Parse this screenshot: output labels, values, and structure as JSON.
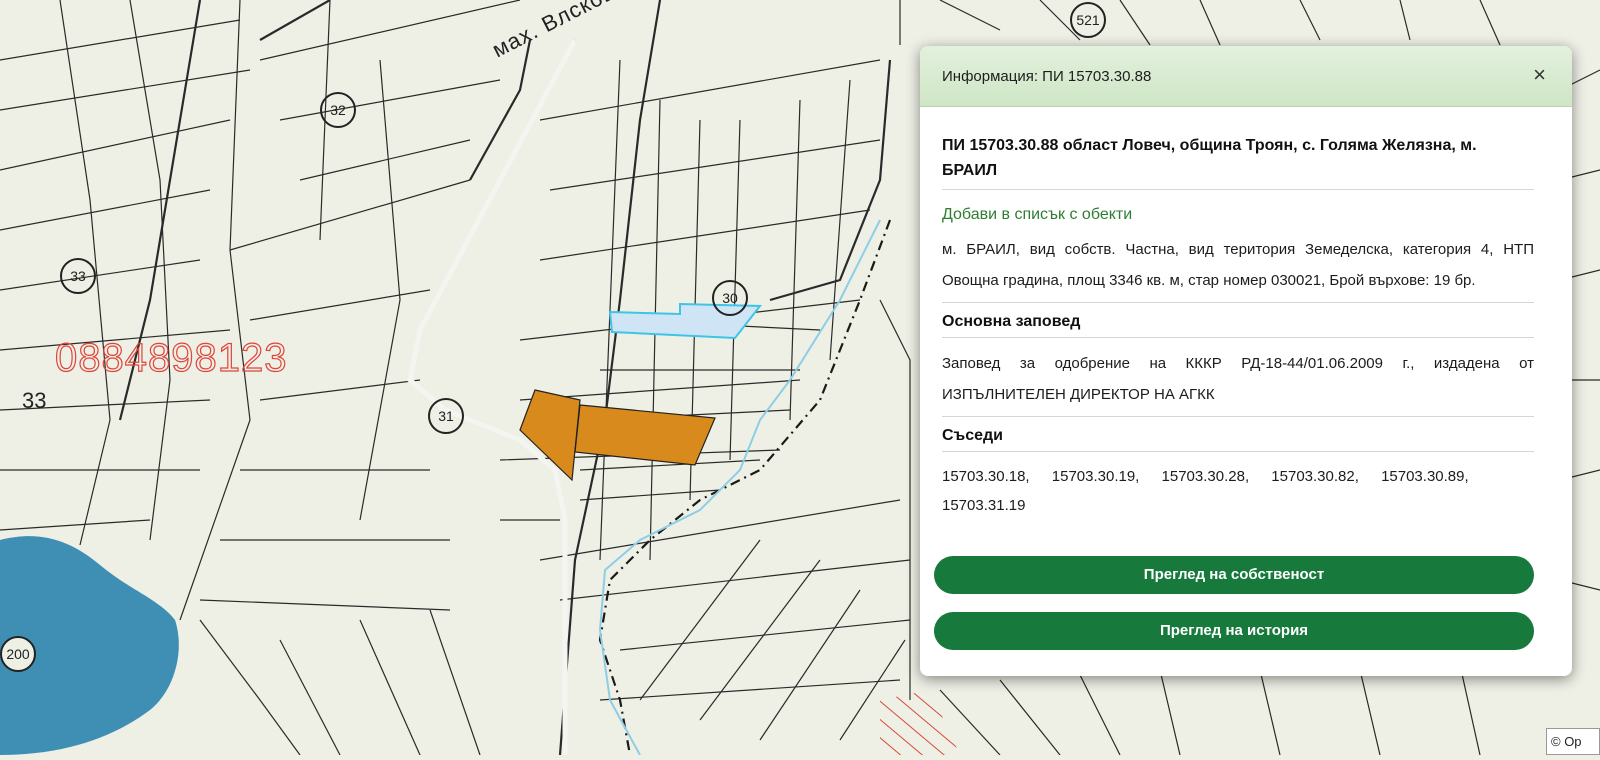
{
  "map": {
    "street_label": "мах. Влсково",
    "watermark": "0884898123",
    "text_33": "33",
    "plot_numbers": [
      "32",
      "33",
      "30",
      "31",
      "200",
      "521"
    ],
    "copyright": "© Ор",
    "colors": {
      "highlight_fill": "#cfe4f5",
      "highlight_stroke": "#3ec4e6",
      "orange": "#d98a1c",
      "water": "#3f8fb4",
      "hatch": "#d94a3a"
    }
  },
  "panel": {
    "title": "Информация: ПИ 15703.30.88",
    "close": "×",
    "parcel_heading": "ПИ 15703.30.88 област Ловеч, община Троян, с. Голяма Желязна, м. БРАИЛ",
    "add_link": "Добави в списък с обекти",
    "description": "м. БРАИЛ, вид собств. Частна, вид територия Земеделска, категория 4, НТП Овощна градина, площ 3346 кв. м, стар номер 030021, Брой върхове: 19 бр.",
    "order_heading": "Основна заповед",
    "order_text": "Заповед за одобрение на КККР РД-18-44/01.06.2009 г., издадена от ИЗПЪЛНИТЕЛЕН ДИРЕКТОР НА АГКК",
    "neighbors_heading": "Съседи",
    "neighbors": [
      "15703.30.18,",
      "15703.30.19,",
      "15703.30.28,",
      "15703.30.82,",
      "15703.30.89,",
      "15703.31.19"
    ],
    "buttons": {
      "ownership": "Преглед на собственост",
      "history": "Преглед на история"
    }
  }
}
